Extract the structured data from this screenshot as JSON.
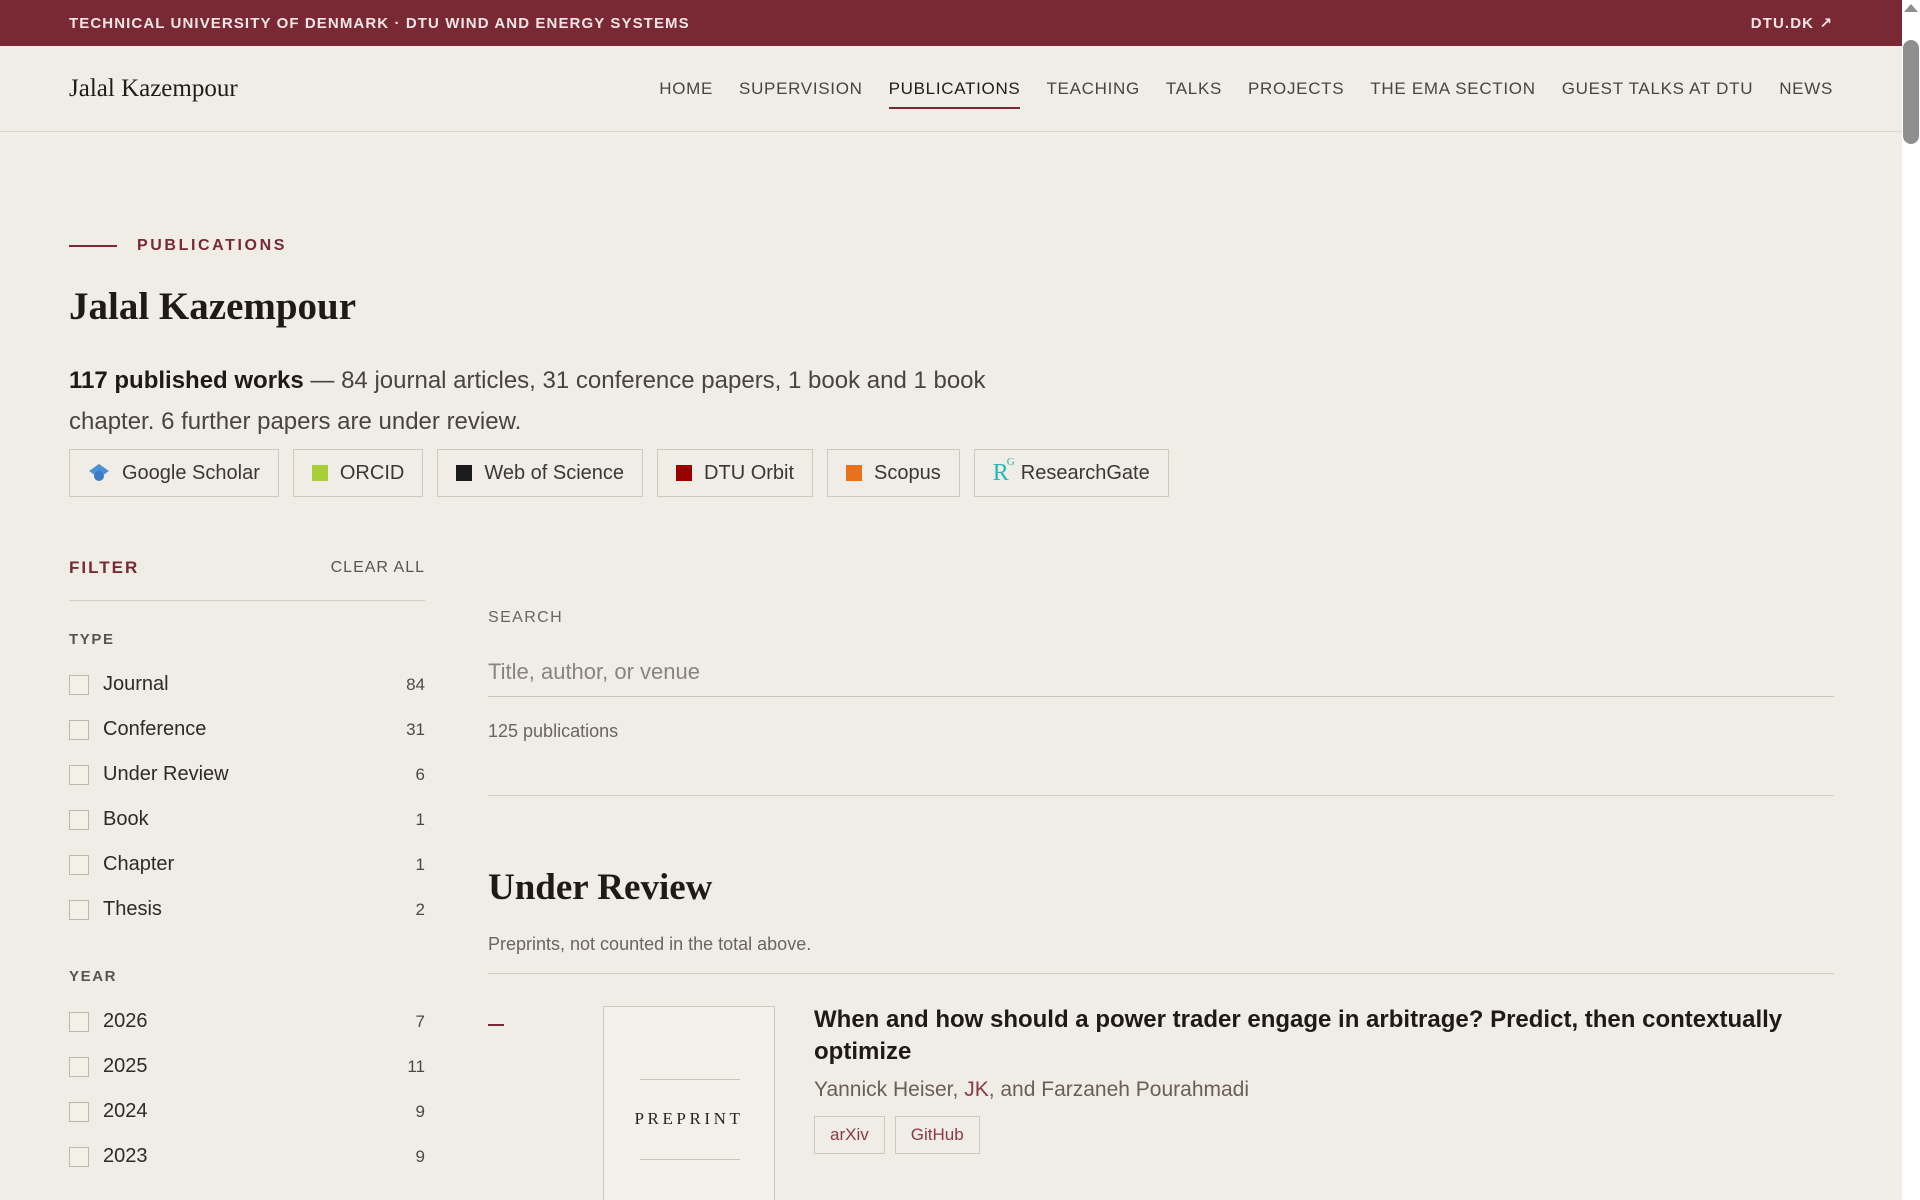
{
  "topbar": {
    "institution": "TECHNICAL UNIVERSITY OF DENMARK · DTU WIND AND ENERGY SYSTEMS",
    "external": "DTU.DK ↗"
  },
  "nav": {
    "brand": "Jalal Kazempour",
    "items": [
      "HOME",
      "SUPERVISION",
      "PUBLICATIONS",
      "TEACHING",
      "TALKS",
      "PROJECTS",
      "THE EMA SECTION",
      "GUEST TALKS AT DTU",
      "NEWS"
    ],
    "active": "PUBLICATIONS"
  },
  "hero": {
    "eyebrow": "PUBLICATIONS",
    "title": "Jalal Kazempour",
    "summary_bold": "117 published works",
    "summary_rest": " — 84 journal articles, 31 conference papers, 1 book and 1 book chapter. 6 further papers are under review."
  },
  "profiles": [
    {
      "label": "Google Scholar",
      "icon": "graduation-cap-icon",
      "color": "#4a8fd9"
    },
    {
      "label": "ORCID",
      "icon": "orcid-square-icon",
      "color": "#a6ce39"
    },
    {
      "label": "Web of Science",
      "icon": "wos-square-icon",
      "color": "#1b1b1b"
    },
    {
      "label": "DTU Orbit",
      "icon": "dtu-square-icon",
      "color": "#990000"
    },
    {
      "label": "Scopus",
      "icon": "scopus-square-icon",
      "color": "#e9711c"
    },
    {
      "label": "ResearchGate",
      "icon": "researchgate-icon",
      "color": "#26b7b5"
    }
  ],
  "filter": {
    "label": "FILTER",
    "clear": "CLEAR ALL",
    "type_title": "TYPE",
    "types": [
      {
        "name": "Journal",
        "count": "84"
      },
      {
        "name": "Conference",
        "count": "31"
      },
      {
        "name": "Under Review",
        "count": "6"
      },
      {
        "name": "Book",
        "count": "1"
      },
      {
        "name": "Chapter",
        "count": "1"
      },
      {
        "name": "Thesis",
        "count": "2"
      }
    ],
    "year_title": "YEAR",
    "years": [
      {
        "name": "2026",
        "count": "7"
      },
      {
        "name": "2025",
        "count": "11"
      },
      {
        "name": "2024",
        "count": "9"
      },
      {
        "name": "2023",
        "count": "9"
      }
    ]
  },
  "search": {
    "label": "SEARCH",
    "placeholder": "Title, author, or venue",
    "value": "",
    "result_count": "125 publications"
  },
  "section": {
    "title": "Under Review",
    "subtitle": "Preprints, not counted in the total above."
  },
  "publications": [
    {
      "thumb_label": "PREPRINT",
      "title": "When and how should a power trader engage in arbitrage? Predict, then contextually optimize",
      "authors_pre": "Yannick Heiser, ",
      "authors_me": "JK",
      "authors_post": ", and Farzaneh Pourahmadi",
      "links": [
        "arXiv",
        "GitHub"
      ]
    }
  ],
  "colors": {
    "accent": "#792934",
    "background": "#f0ece6"
  }
}
